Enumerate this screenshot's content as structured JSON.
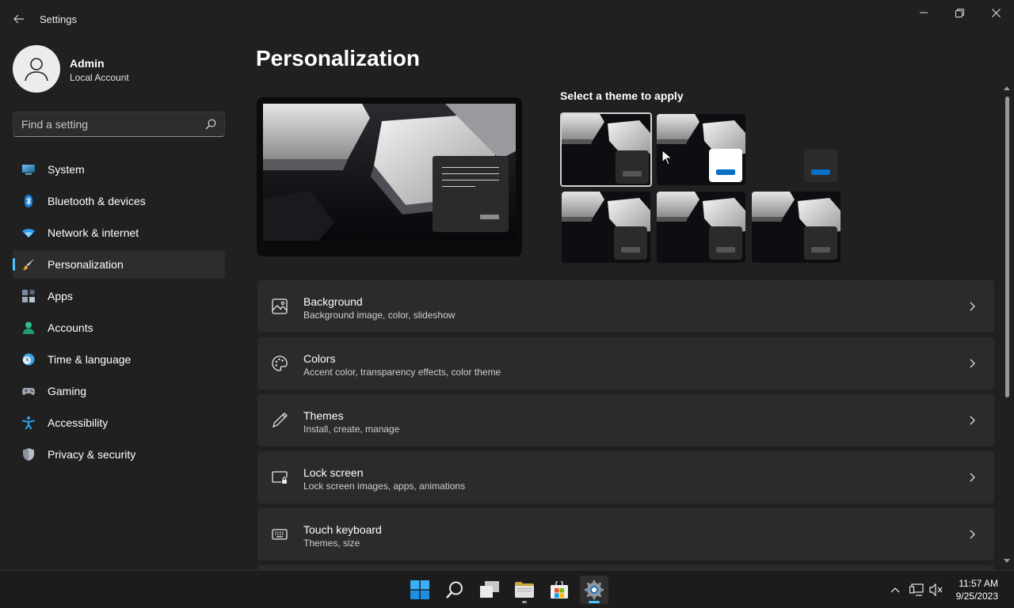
{
  "window": {
    "title": "Settings"
  },
  "user": {
    "name": "Admin",
    "account_type": "Local Account"
  },
  "search": {
    "placeholder": "Find a setting"
  },
  "nav": {
    "items": [
      {
        "label": "System",
        "icon": "system-icon"
      },
      {
        "label": "Bluetooth & devices",
        "icon": "bluetooth-icon"
      },
      {
        "label": "Network & internet",
        "icon": "wifi-icon"
      },
      {
        "label": "Personalization",
        "icon": "brush-icon",
        "selected": true
      },
      {
        "label": "Apps",
        "icon": "apps-icon"
      },
      {
        "label": "Accounts",
        "icon": "person-icon"
      },
      {
        "label": "Time & language",
        "icon": "clock-globe-icon"
      },
      {
        "label": "Gaming",
        "icon": "gamepad-icon"
      },
      {
        "label": "Accessibility",
        "icon": "accessibility-icon"
      },
      {
        "label": "Privacy & security",
        "icon": "shield-icon"
      }
    ]
  },
  "main": {
    "title": "Personalization",
    "theme_heading": "Select a theme to apply",
    "themes": [
      {
        "window_style": "dark",
        "selected": true
      },
      {
        "window_style": "light"
      },
      {
        "window_style": "empty"
      },
      {
        "window_style": "dark"
      },
      {
        "window_style": "dark"
      },
      {
        "window_style": "dark"
      }
    ],
    "cards": [
      {
        "title": "Background",
        "subtitle": "Background image, color, slideshow",
        "icon": "image-icon"
      },
      {
        "title": "Colors",
        "subtitle": "Accent color, transparency effects, color theme",
        "icon": "palette-icon"
      },
      {
        "title": "Themes",
        "subtitle": "Install, create, manage",
        "icon": "pen-icon"
      },
      {
        "title": "Lock screen",
        "subtitle": "Lock screen images, apps, animations",
        "icon": "lock-screen-icon"
      },
      {
        "title": "Touch keyboard",
        "subtitle": "Themes, size",
        "icon": "keyboard-icon"
      }
    ]
  },
  "taskbar": {
    "apps": [
      "start",
      "search",
      "task-view",
      "file-explorer",
      "store",
      "settings"
    ],
    "time": "11:57 AM",
    "date": "9/25/2023"
  },
  "colors": {
    "accent": "#4cc2ff",
    "background": "#202020",
    "card": "#2b2b2b",
    "theme_blue": "#0a6fc6"
  }
}
